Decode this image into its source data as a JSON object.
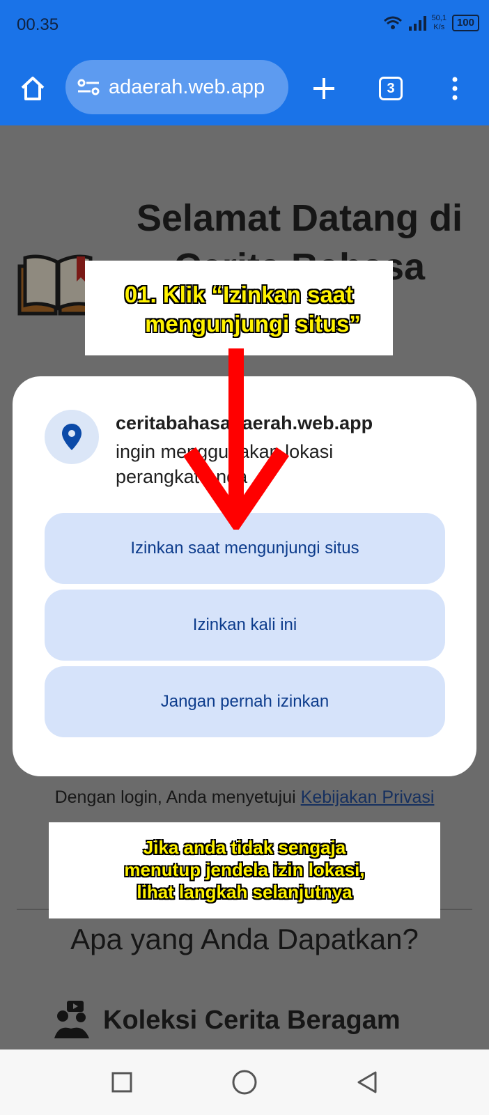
{
  "status_bar": {
    "time": "00.35",
    "speed_value": "50,1",
    "speed_unit": "K/s",
    "battery": "100"
  },
  "browser": {
    "url": "adaerah.web.app",
    "tab_count": "3",
    "accent": "#1a73e8"
  },
  "page": {
    "welcome": "Selamat Datang di Cerita Bahasa Daerah",
    "login_note": "Dengan login, Anda menyetujui",
    "privacy_link": "Kebijakan Privasi",
    "section_title": "Apa yang Anda Dapatkan?",
    "feature_1": "Koleksi Cerita Beragam"
  },
  "dialog": {
    "site": "ceritabahasadaerah.web.app",
    "message": "ingin menggunakan lokasi perangkat Anda",
    "buttons": [
      {
        "label": "Izinkan saat mengunjungi situs"
      },
      {
        "label": "Izinkan kali ini"
      },
      {
        "label": "Jangan pernah izinkan"
      }
    ]
  },
  "annotations": {
    "step_line1": "01.  Klik “Izinkan saat",
    "step_line2": "mengunjungi situs”",
    "note_line1": "Jika anda tidak sengaja",
    "note_line2": "menutup jendela izin lokasi,",
    "note_line3": "lihat langkah selanjutnya",
    "highlight_color": "#fff200",
    "arrow_color": "#ff0000"
  }
}
